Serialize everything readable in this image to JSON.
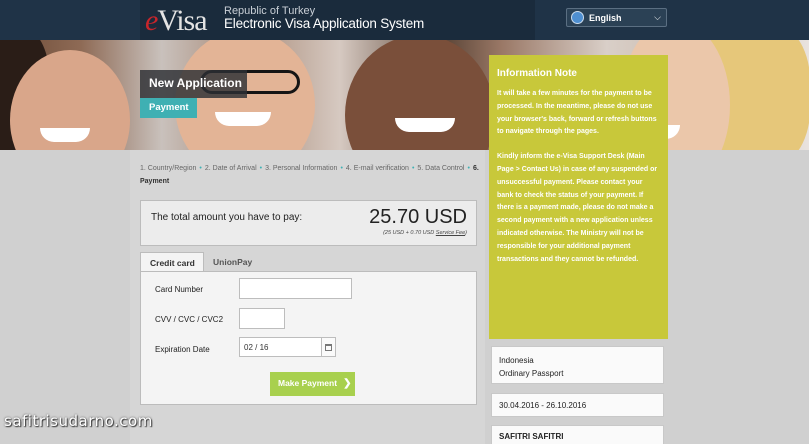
{
  "header": {
    "logo_e": "e",
    "logo_text": "Visa",
    "subtitle": "Republic of Turkey",
    "title": "Electronic Visa Application System",
    "language": "English"
  },
  "banner": {
    "section_title": "New Application",
    "step_label": "Payment"
  },
  "breadcrumb": {
    "steps": [
      "1. Country/Region",
      "2. Date of Arrival",
      "3. Personal Information",
      "4. E-mail verification",
      "5. Data Control",
      "6. Payment"
    ]
  },
  "amount": {
    "label": "The total amount you have to pay:",
    "value": "25.70 USD",
    "detail_prefix": "(25 USD + 0.70 USD ",
    "detail_link": "Service Fee",
    "detail_suffix": ")"
  },
  "tabs": {
    "credit_card": "Credit card",
    "unionpay": "UnionPay"
  },
  "form": {
    "card_number_label": "Card Number",
    "card_number_value": "",
    "cvv_label": "CVV / CVC / CVC2",
    "cvv_value": "",
    "expiration_label": "Expiration Date",
    "expiration_value": "02 / 16",
    "pay_button": "Make Payment"
  },
  "info_note": {
    "title": "Information Note",
    "paragraph1": "It will take a few minutes for the payment to be processed. In the meantime, please do not use your browser's back, forward or refresh buttons to navigate through the pages.",
    "paragraph2": "Kindly inform the e-Visa Support Desk (Main Page > Contact Us) in case of any suspended or unsuccessful payment. Please contact your bank to check the status of your payment. If there is a payment made, please do not make a second payment with a new application unless indicated otherwise. The Ministry will not be responsible for your additional payment transactions and they cannot be refunded."
  },
  "summary": {
    "country": "Indonesia",
    "passport": "Ordinary Passport",
    "dates": "30.04.2016 - 26.10.2016",
    "name": "SAFITRI SAFITRI"
  },
  "watermark": "safitrisudarno.com",
  "colors": {
    "header_bg": "#1f3347",
    "accent_teal": "#3fb0b3",
    "info_bg": "#c8c83a",
    "pay_button": "#a8d04e",
    "logo_red": "#c7252b"
  }
}
